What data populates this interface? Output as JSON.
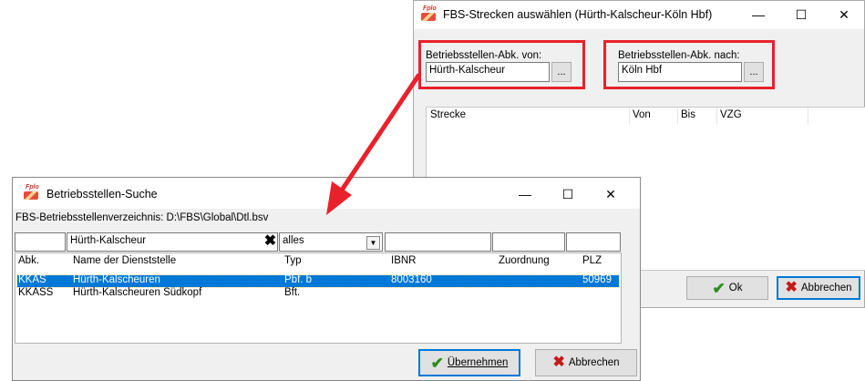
{
  "strecken": {
    "title": "FBS-Strecken auswählen (Hürth-Kalscheur-Köln Hbf)",
    "von_label": "Betriebsstellen-Abk. von:",
    "von_value": "Hürth-Kalscheur",
    "nach_label": "Betriebsstellen-Abk. nach:",
    "nach_value": "Köln Hbf",
    "browse_label": "...",
    "columns": [
      "Strecke",
      "Von",
      "Bis",
      "VZG"
    ],
    "ok_label": "Ok",
    "abbrechen_label": "Abbrechen"
  },
  "suche": {
    "title": "Betriebsstellen-Suche",
    "verzeichnis": "FBS-Betriebsstellenverzeichnis: D:\\FBS\\Global\\Dtl.bsv",
    "filter_name": "Hürth-Kalscheur",
    "filter_typ": "alles",
    "columns": [
      "Abk.",
      "Name der Dienststelle",
      "Typ",
      "IBNR",
      "Zuordnung",
      "PLZ"
    ],
    "rows": [
      {
        "abk": "KKAS",
        "name": "Hürth-Kalscheuren",
        "typ": "Pbf. b",
        "ibnr": "8003160",
        "zuordnung": "",
        "plz": "50969"
      },
      {
        "abk": "KKASS",
        "name": "Hürth-Kalscheuren Südkopf",
        "typ": "Bft.",
        "ibnr": "",
        "zuordnung": "",
        "plz": ""
      }
    ],
    "uebernehmen_label": "Übernehmen",
    "abbrechen_label": "Abbrechen"
  },
  "window_controls": {
    "minimize": "—",
    "maximize": "☐",
    "close": "✕"
  },
  "colors": {
    "highlight_red": "#e8212b",
    "selection_blue": "#0078d7",
    "arrow_red": "#e8212b"
  }
}
